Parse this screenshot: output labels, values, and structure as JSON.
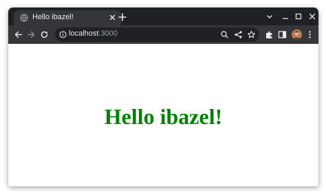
{
  "window": {
    "tab": {
      "title": "Hello ibazel!",
      "favicon": "globe-icon"
    },
    "controls": [
      "chevron-down-icon",
      "minimize-icon",
      "maximize-icon",
      "close-icon"
    ]
  },
  "toolbar": {
    "url_host": "localhost",
    "url_port": ":3000",
    "icons": [
      "back-arrow-icon",
      "forward-arrow-icon",
      "reload-icon",
      "info-icon",
      "zoom-icon",
      "share-icon",
      "star-icon",
      "extensions-puzzle-icon",
      "side-panel-icon",
      "profile-avatar",
      "more-vert-icon"
    ]
  },
  "page": {
    "heading": "Hello ibazel!",
    "heading_color": "#008000"
  },
  "colors": {
    "tabstrip": "#202124",
    "toolbar": "#35363a",
    "omnibox": "#202124",
    "icon": "#e8eaed"
  }
}
